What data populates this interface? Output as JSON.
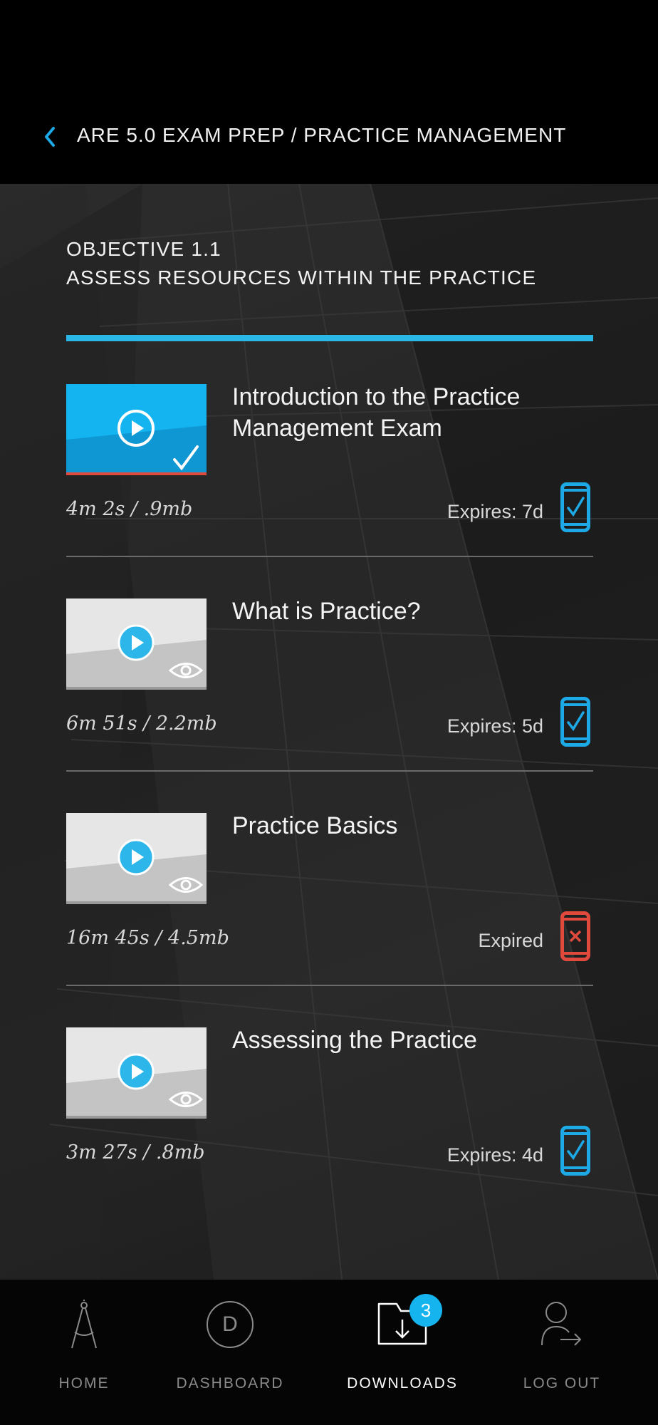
{
  "header": {
    "breadcrumb": "ARE 5.0 EXAM PREP / PRACTICE MANAGEMENT",
    "back_icon": "chevron-left-icon"
  },
  "objective": {
    "line1": "OBJECTIVE 1.1",
    "line2": "ASSESS RESOURCES WITHIN THE PRACTICE"
  },
  "lessons": [
    {
      "title": "Introduction to the Practice Management Exam",
      "duration": "4m 2s",
      "size": ".9mb",
      "expiry": "Expires: 7d",
      "state": "completed",
      "thumb_icon": "checkmark-icon",
      "device_icon": "device-check-icon",
      "device_color": "#1da8e6"
    },
    {
      "title": "What is Practice?",
      "duration": "6m 51s",
      "size": "2.2mb",
      "expiry": "Expires: 5d",
      "state": "unwatched",
      "thumb_icon": "eye-icon",
      "device_icon": "device-check-icon",
      "device_color": "#1da8e6"
    },
    {
      "title": "Practice Basics",
      "duration": "16m 45s",
      "size": "4.5mb",
      "expiry": "Expired",
      "state": "unwatched",
      "thumb_icon": "eye-icon",
      "device_icon": "device-expired-icon",
      "device_color": "#e0493c"
    },
    {
      "title": "Assessing the Practice",
      "duration": "3m 27s",
      "size": ".8mb",
      "expiry": "Expires: 4d",
      "state": "unwatched",
      "thumb_icon": "eye-icon",
      "device_icon": "device-check-icon",
      "device_color": "#1da8e6"
    }
  ],
  "separator": " / ",
  "tabbar": {
    "home": "HOME",
    "dashboard": "DASHBOARD",
    "dashboard_letter": "D",
    "downloads": "DOWNLOADS",
    "downloads_badge": "3",
    "logout": "LOG OUT",
    "active": "downloads"
  },
  "colors": {
    "accent": "#2bb7e6",
    "expired": "#e0493c",
    "completed_progress": "#e0493c"
  }
}
